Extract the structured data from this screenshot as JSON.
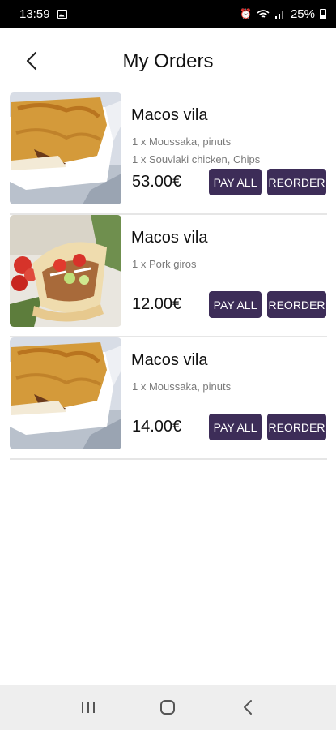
{
  "status_bar": {
    "time": "13:59",
    "battery": "25%",
    "icons": [
      "image-icon",
      "alarm-icon",
      "wifi-icon",
      "signal-icon",
      "battery-icon"
    ]
  },
  "header": {
    "title": "My Orders",
    "back_icon": "chevron-left-icon"
  },
  "orders": [
    {
      "store": "Macos vila",
      "image": "moussaka-photo",
      "items": [
        "1 x Moussaka, pinuts",
        "1 x Souvlaki chicken, Chips"
      ],
      "total": "53.00€",
      "pay_label": "PAY ALL",
      "reorder_label": "REORDER"
    },
    {
      "store": "Macos vila",
      "image": "pork-gyros-photo",
      "items": [
        "1 x Pork giros"
      ],
      "total": "12.00€",
      "pay_label": "PAY ALL",
      "reorder_label": "REORDER"
    },
    {
      "store": "Macos vila",
      "image": "moussaka-photo",
      "items": [
        "1 x Moussaka, pinuts"
      ],
      "total": "14.00€",
      "pay_label": "PAY ALL",
      "reorder_label": "REORDER"
    }
  ],
  "nav_bar": {
    "icons": [
      "recent-apps-icon",
      "home-icon",
      "back-icon"
    ]
  },
  "colors": {
    "button_bg": "#3d2d58",
    "button_text": "#ffffff",
    "status_bar_bg": "#000000",
    "nav_bar_bg": "#eeeeee",
    "secondary_text": "#7a7a7a"
  }
}
